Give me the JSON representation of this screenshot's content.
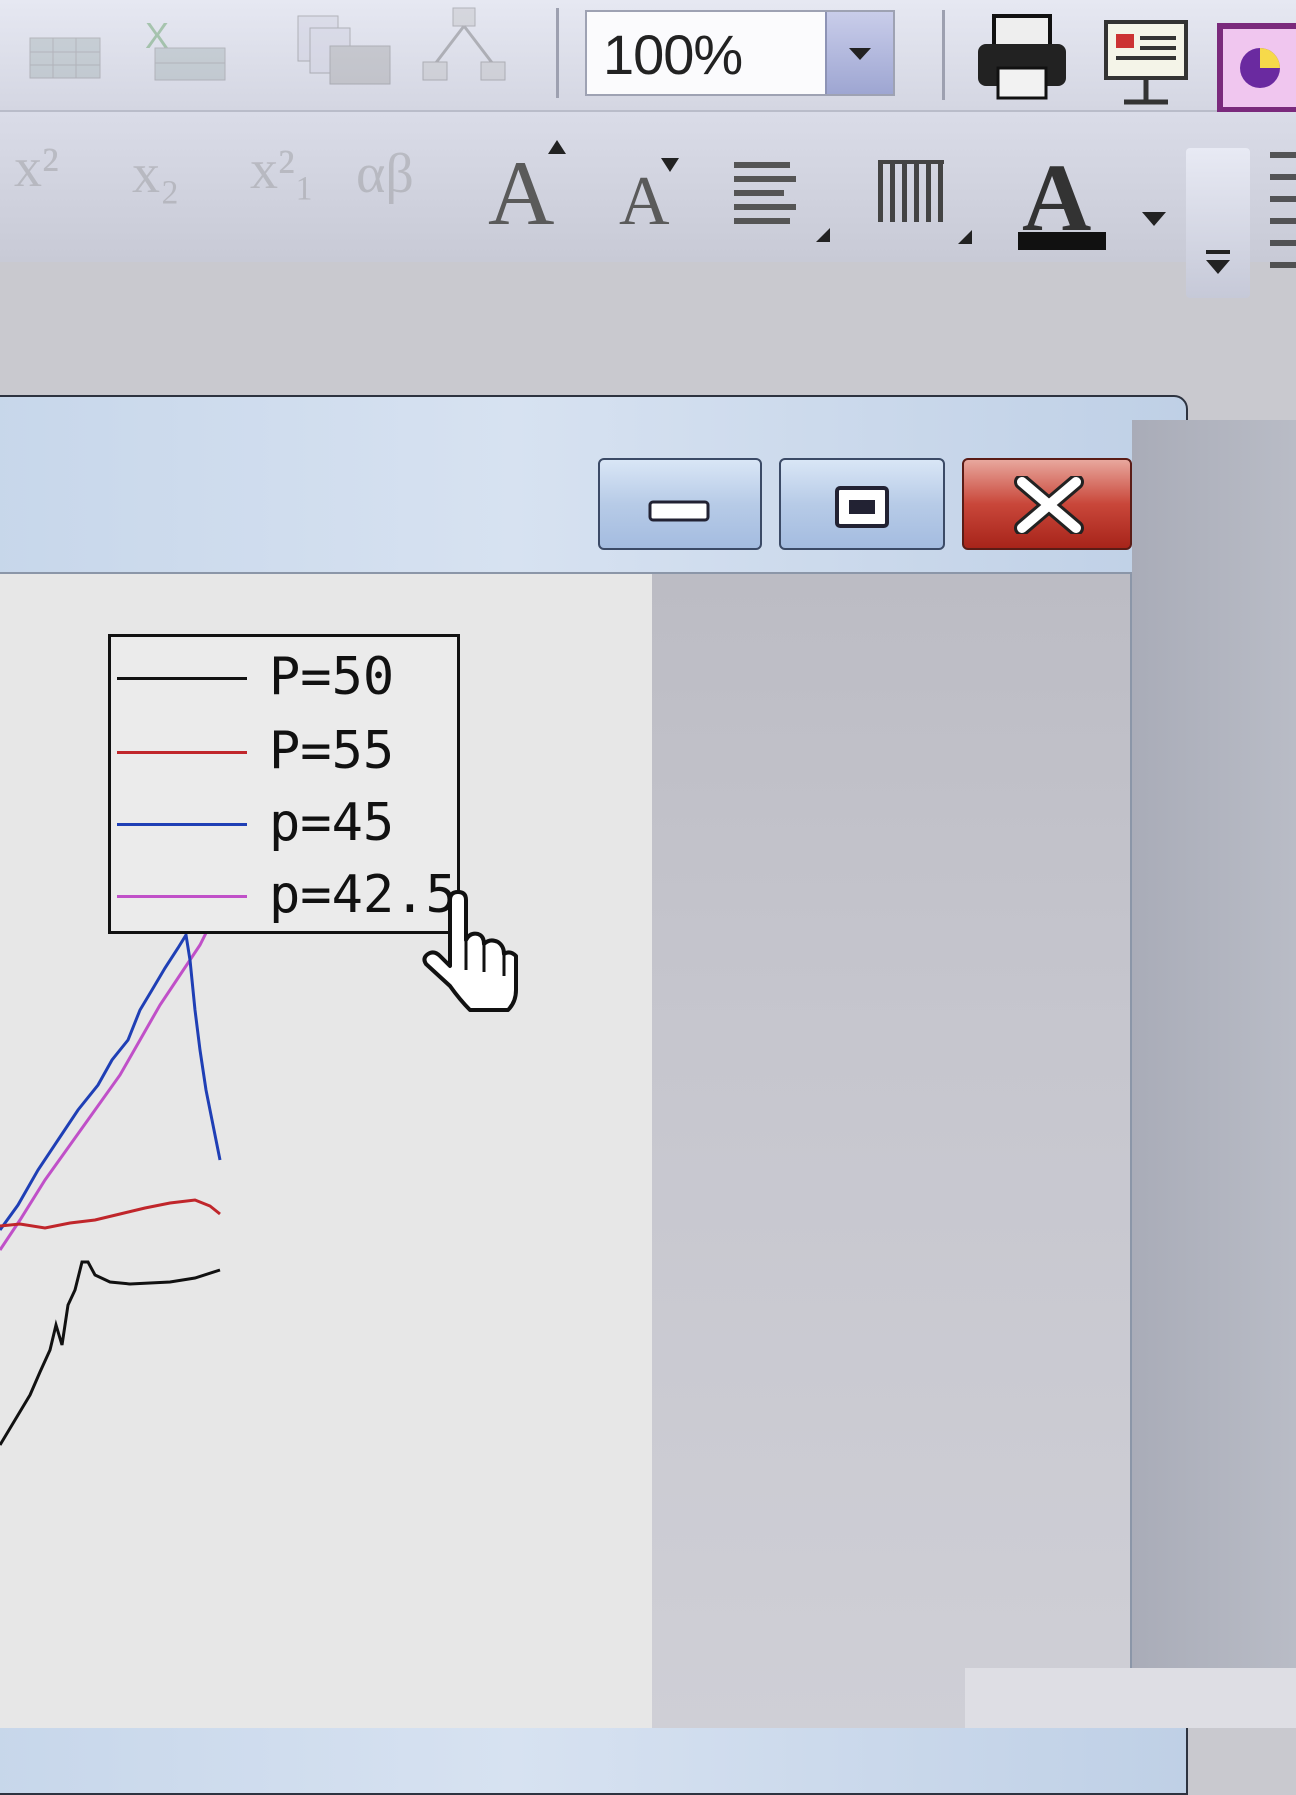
{
  "toolbar": {
    "zoom_value": "100%",
    "format_labels": [
      "x²",
      "x₂",
      "x²₁",
      "αβ"
    ],
    "font_color_label": "A"
  },
  "window": {
    "buttons": [
      "minimize",
      "maximize",
      "close"
    ]
  },
  "chart_data": {
    "type": "line",
    "series": [
      {
        "name": "P=50",
        "color": "#111111"
      },
      {
        "name": "P=55",
        "color": "#c0262b"
      },
      {
        "name": "p=45",
        "color": "#1f3fb5"
      },
      {
        "name": "p=42.5",
        "color": "#c050c8"
      }
    ],
    "legend_position": "top-right",
    "grid": false
  }
}
